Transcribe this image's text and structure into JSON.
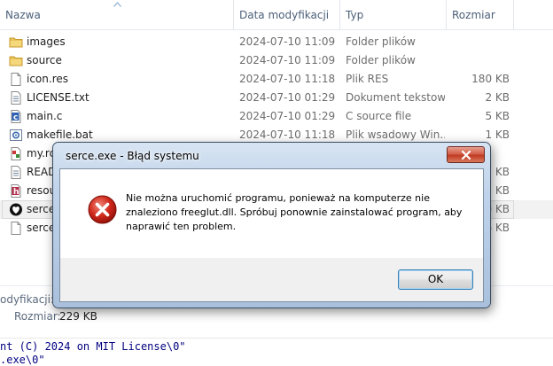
{
  "columns": {
    "name": "Nazwa",
    "date": "Data modyfikacji",
    "type": "Typ",
    "size": "Rozmiar"
  },
  "files": [
    {
      "name": "images",
      "date": "2024-07-10 11:09",
      "type": "Folder plików",
      "size": "",
      "icon": "folder-icon"
    },
    {
      "name": "source",
      "date": "2024-07-10 11:09",
      "type": "Folder plików",
      "size": "",
      "icon": "folder-icon"
    },
    {
      "name": "icon.res",
      "date": "2024-07-10 11:18",
      "type": "Plik RES",
      "size": "180 KB",
      "icon": "file-icon"
    },
    {
      "name": "LICENSE.txt",
      "date": "2024-07-10 01:29",
      "type": "Dokument tekstowy",
      "size": "2 KB",
      "icon": "text-file-icon"
    },
    {
      "name": "main.c",
      "date": "2024-07-10 01:29",
      "type": "C source file",
      "size": "5 KB",
      "icon": "c-source-icon"
    },
    {
      "name": "makefile.bat",
      "date": "2024-07-10 11:18",
      "type": "Plik wsadowy Win...",
      "size": "1 KB",
      "icon": "batch-file-icon"
    },
    {
      "name": "my.rc",
      "date": "",
      "type": "",
      "size": "",
      "icon": "rc-file-icon"
    },
    {
      "name": "READM",
      "date": "",
      "type": "",
      "size": "1 KB",
      "icon": "text-file-icon"
    },
    {
      "name": "resour",
      "date": "",
      "type": "",
      "size": "1 KB",
      "icon": "header-file-icon"
    },
    {
      "name": "serce.e",
      "date": "",
      "type": "",
      "size": "30 KB",
      "icon": "heart-app-icon"
    },
    {
      "name": "serce.o",
      "date": "",
      "type": "",
      "size": "6 KB",
      "icon": "file-icon"
    }
  ],
  "details": {
    "modified_label": "odyfikacji:",
    "size_label": "Rozmiar:",
    "size_value": "229 KB"
  },
  "code_lines": [
    "nt (C) 2024 on MIT License\\0\"",
    ".exe\\0\""
  ],
  "dialog": {
    "title": "serce.exe - Błąd systemu",
    "message": "Nie można uruchomić programu, ponieważ na komputerze nie znaleziono freeglut.dll. Spróbuj ponownie zainstalować program, aby naprawić ten problem.",
    "ok_label": "OK"
  }
}
